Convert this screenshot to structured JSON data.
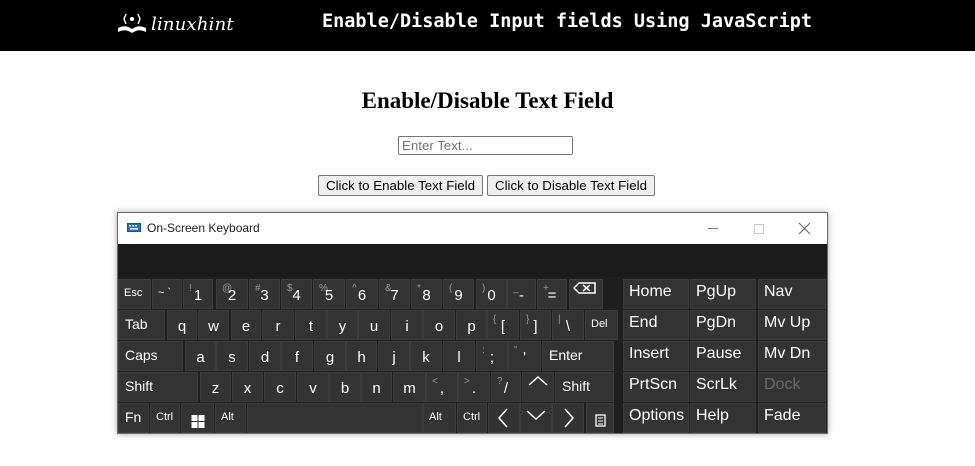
{
  "banner": {
    "logo_text": "linuxhint",
    "title": "Enable/Disable Input fields Using JavaScript"
  },
  "page": {
    "heading": "Enable/Disable Text Field",
    "input_placeholder": "Enter Text...",
    "enable_button": "Click to Enable Text Field",
    "disable_button": "Click to Disable Text Field"
  },
  "osk": {
    "title": "On-Screen Keyboard",
    "rows": [
      [
        {
          "label": "Esc",
          "type": "sm"
        },
        {
          "label": "~ `",
          "type": "sm"
        },
        {
          "label": "1",
          "shift": "!"
        },
        {
          "label": "2",
          "shift": "@"
        },
        {
          "label": "3",
          "shift": "#"
        },
        {
          "label": "4",
          "shift": "$"
        },
        {
          "label": "5",
          "shift": "%"
        },
        {
          "label": "6",
          "shift": "^"
        },
        {
          "label": "7",
          "shift": "&"
        },
        {
          "label": "8",
          "shift": "*"
        },
        {
          "label": "9",
          "shift": "("
        },
        {
          "label": "0",
          "shift": ")"
        },
        {
          "label": "-",
          "shift": "_"
        },
        {
          "label": "=",
          "shift": "+"
        },
        {
          "label": "",
          "icon": "backspace-icon"
        }
      ],
      [
        {
          "label": "Tab",
          "type": "lbl"
        },
        {
          "label": "q"
        },
        {
          "label": "w"
        },
        {
          "label": "e"
        },
        {
          "label": "r"
        },
        {
          "label": "t"
        },
        {
          "label": "y"
        },
        {
          "label": "u"
        },
        {
          "label": "i"
        },
        {
          "label": "o"
        },
        {
          "label": "p"
        },
        {
          "label": "[",
          "shift": "{"
        },
        {
          "label": "]",
          "shift": "}"
        },
        {
          "label": "\\",
          "shift": "|"
        },
        {
          "label": "Del",
          "type": "sm"
        }
      ],
      [
        {
          "label": "Caps",
          "type": "lbl"
        },
        {
          "label": "a"
        },
        {
          "label": "s"
        },
        {
          "label": "d"
        },
        {
          "label": "f"
        },
        {
          "label": "g"
        },
        {
          "label": "h"
        },
        {
          "label": "j"
        },
        {
          "label": "k"
        },
        {
          "label": "l"
        },
        {
          "label": ";",
          "shift": ":"
        },
        {
          "label": "'",
          "shift": "\""
        },
        {
          "label": "Enter",
          "type": "lbl"
        }
      ],
      [
        {
          "label": "Shift",
          "type": "lbl"
        },
        {
          "label": "z"
        },
        {
          "label": "x"
        },
        {
          "label": "c"
        },
        {
          "label": "v"
        },
        {
          "label": "b"
        },
        {
          "label": "n"
        },
        {
          "label": "m"
        },
        {
          "label": ",",
          "shift": "<"
        },
        {
          "label": ".",
          "shift": ">"
        },
        {
          "label": "/",
          "shift": "?"
        },
        {
          "label": "",
          "icon": "arrow-up-icon"
        },
        {
          "label": "Shift",
          "type": "lbl"
        }
      ],
      [
        {
          "label": "Fn",
          "type": "lbl"
        },
        {
          "label": "Ctrl",
          "type": "sm"
        },
        {
          "label": "",
          "icon": "windows-icon"
        },
        {
          "label": "Alt",
          "type": "sm"
        },
        {
          "label": ""
        },
        {
          "label": "Alt",
          "type": "sm"
        },
        {
          "label": "Ctrl",
          "type": "sm"
        },
        {
          "label": "",
          "icon": "arrow-left-icon"
        },
        {
          "label": "",
          "icon": "arrow-down-icon"
        },
        {
          "label": "",
          "icon": "arrow-right-icon"
        },
        {
          "label": "",
          "icon": "menu-icon"
        }
      ]
    ],
    "nav_keys": [
      [
        "Home",
        "PgUp",
        "Nav"
      ],
      [
        "End",
        "PgDn",
        "Mv Up"
      ],
      [
        "Insert",
        "Pause",
        "Mv Dn"
      ],
      [
        "PrtScn",
        "ScrLk",
        "Dock"
      ],
      [
        "Options",
        "Help",
        "Fade"
      ]
    ],
    "dimmed_key": "Dock"
  }
}
